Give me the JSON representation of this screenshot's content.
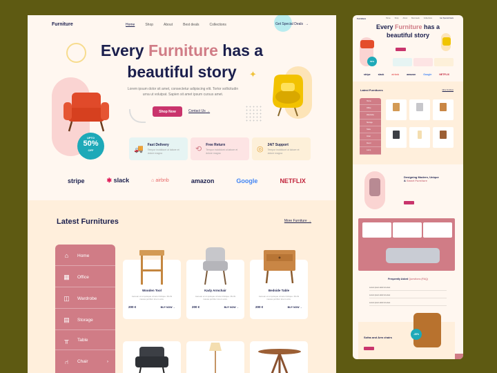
{
  "nav": {
    "logo": "Furniture",
    "links": [
      "Home",
      "Shop",
      "About",
      "Best deals",
      "Collections"
    ],
    "cta": "Get Special Deals"
  },
  "hero": {
    "title_part1": "Every ",
    "title_accent": "Furniture",
    "title_part2": " has a",
    "title_line2": "beautiful story",
    "subtitle_line1": "Lorem ipsum dolor sit amet, consectetur adipiscing elit. Tortor sollicitudin",
    "subtitle_line2": "urna ut volutpat. Sapien sit amet ipsum cursus amet.",
    "shop_button": "Shop Now",
    "contact_link": "Contact Us",
    "badge_top": "UPTO",
    "badge_value": "50%",
    "badge_bottom": "OFF"
  },
  "features": [
    {
      "title": "Fast Delivery",
      "desc": "Tempor incididunt ut labore et dolore magna",
      "bg": "#e6f4f3",
      "icon": "truck-icon"
    },
    {
      "title": "Free Return",
      "desc": "Tempor incididunt ut labore et dolore magna",
      "bg": "#fde4e4",
      "icon": "return-truck-icon"
    },
    {
      "title": "24/7 Support",
      "desc": "Tempor incididunt ut labore et dolore magna",
      "bg": "#fdf0d9",
      "icon": "support-icon"
    }
  ],
  "brands": [
    "stripe",
    "slack",
    "airbnb",
    "amazon",
    "Google",
    "NETFLIX"
  ],
  "latest": {
    "title": "Latest Furnitures",
    "more_link": "More Furniture",
    "sidebar": [
      "Home",
      "Office",
      "Wardrobe",
      "Storage",
      "Table",
      "Chair"
    ],
    "products": [
      {
        "name": "Wooden Tool",
        "desc": "Aenean et ut quisque ornare tristique. Morbi massa porttitor lorem arcu.",
        "price": "200 €",
        "buy": "BUY NOW"
      },
      {
        "name": "Kady Armchair",
        "desc": "Aenean et ut quisque ornare tristique. Morbi massa porttitor lorem arcu.",
        "price": "200 €",
        "buy": "BUY NOW"
      },
      {
        "name": "Bedside Table",
        "desc": "Aenean et ut quisque ornare tristique. Morbi massa porttitor lorem arcu.",
        "price": "200 €",
        "buy": "BUY NOW"
      }
    ]
  },
  "preview": {
    "logo": "Furniture",
    "links": [
      "Home",
      "Shop",
      "About",
      "Best deals",
      "Collections"
    ],
    "cta": "Get Special Deals",
    "title_part1": "Every ",
    "title_accent": "Furniture",
    "title_part2": " has a",
    "title_line2": "beautiful story",
    "badge": "50%",
    "brands": [
      "stripe",
      "slack",
      "airbnb",
      "amazon",
      "Google",
      "NETFLIX"
    ],
    "latest_title": "Latest Furnitures",
    "more": "More Furniture",
    "sidebar": [
      "Home",
      "Office",
      "Wardrobe",
      "Storage",
      "Table",
      "Chair",
      "Decor",
      "Lamp"
    ],
    "mid_title1": "Designing Modern, Unique",
    "mid_title2": "& ",
    "mid_accent": "Smart Furniture",
    "faq_title": "Frequently Asked ",
    "faq_accent": "Questions (FAQ)",
    "faq_items": [
      "Lorem ipsum dolor sit amet",
      "Lorem ipsum dolor sit amet",
      "Lorem ipsum dolor sit amet"
    ],
    "bottom_title": "Sofas and Arm chairs",
    "bottom_badge": "-35%"
  }
}
